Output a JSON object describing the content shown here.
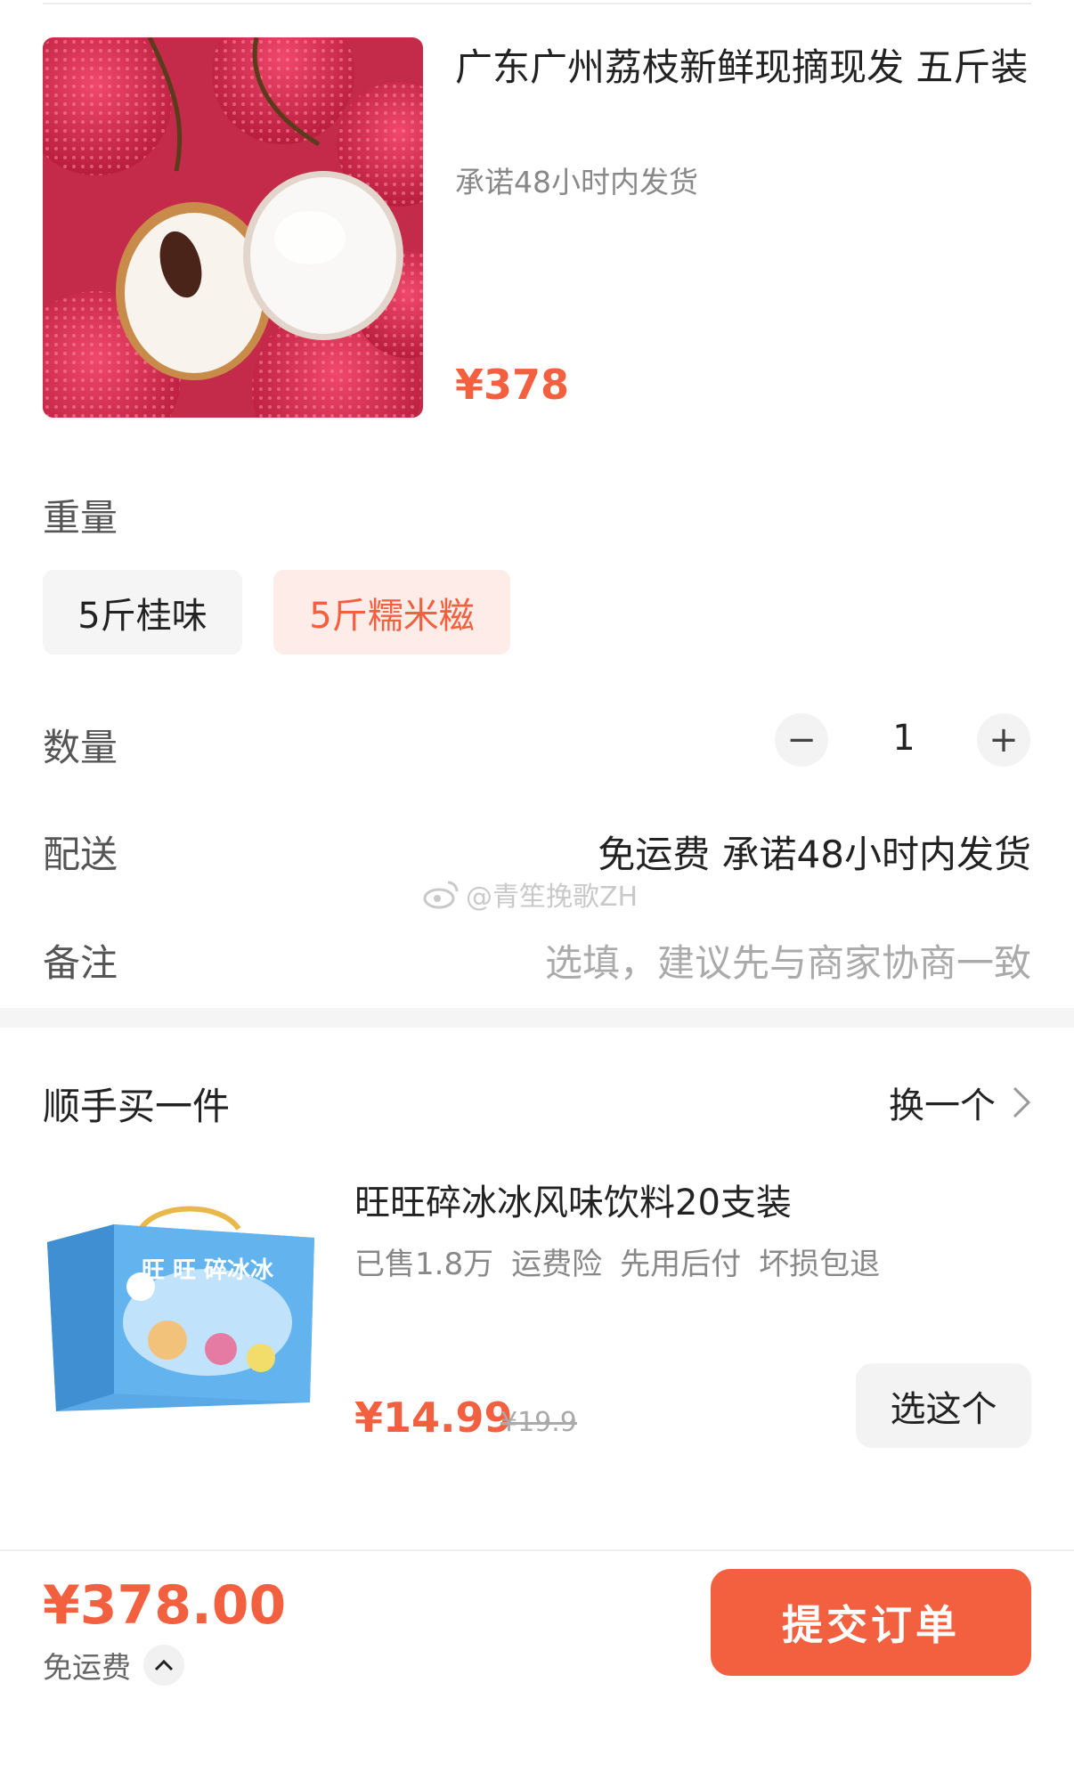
{
  "product": {
    "title": "广东广州荔枝新鲜现摘现发 五斤装",
    "subtitle": "承诺48小时内发货",
    "price": "¥378",
    "image_icon": "lychee-photo"
  },
  "weight": {
    "label": "重量",
    "options": [
      "5斤桂味",
      "5斤糯米糍"
    ],
    "selected": "5斤糯米糍"
  },
  "quantity": {
    "label": "数量",
    "minus": "−",
    "value": "1",
    "plus": "+"
  },
  "delivery": {
    "label": "配送",
    "value": "免运费 承诺48小时内发货"
  },
  "note": {
    "label": "备注",
    "placeholder": "选填，建议先与商家协商一致"
  },
  "watermark": {
    "text": "@青笙挽歌ZH"
  },
  "addon": {
    "title": "顺手买一件",
    "swap_label": "换一个",
    "product_name": "旺旺碎冰冰风味饮料20支装",
    "tags": [
      "已售1.8万",
      "运费险",
      "先用后付",
      "坏损包退"
    ],
    "price": "¥14.99",
    "old_price": "¥19.9",
    "choose_label": "选这个",
    "box_text": "旺 旺 碎冰冰"
  },
  "footer": {
    "total": "¥378.00",
    "shipping": "免运费",
    "submit_label": "提交订单"
  },
  "colors": {
    "accent": "#f2603f",
    "chip_selected_bg": "#fdece7"
  }
}
